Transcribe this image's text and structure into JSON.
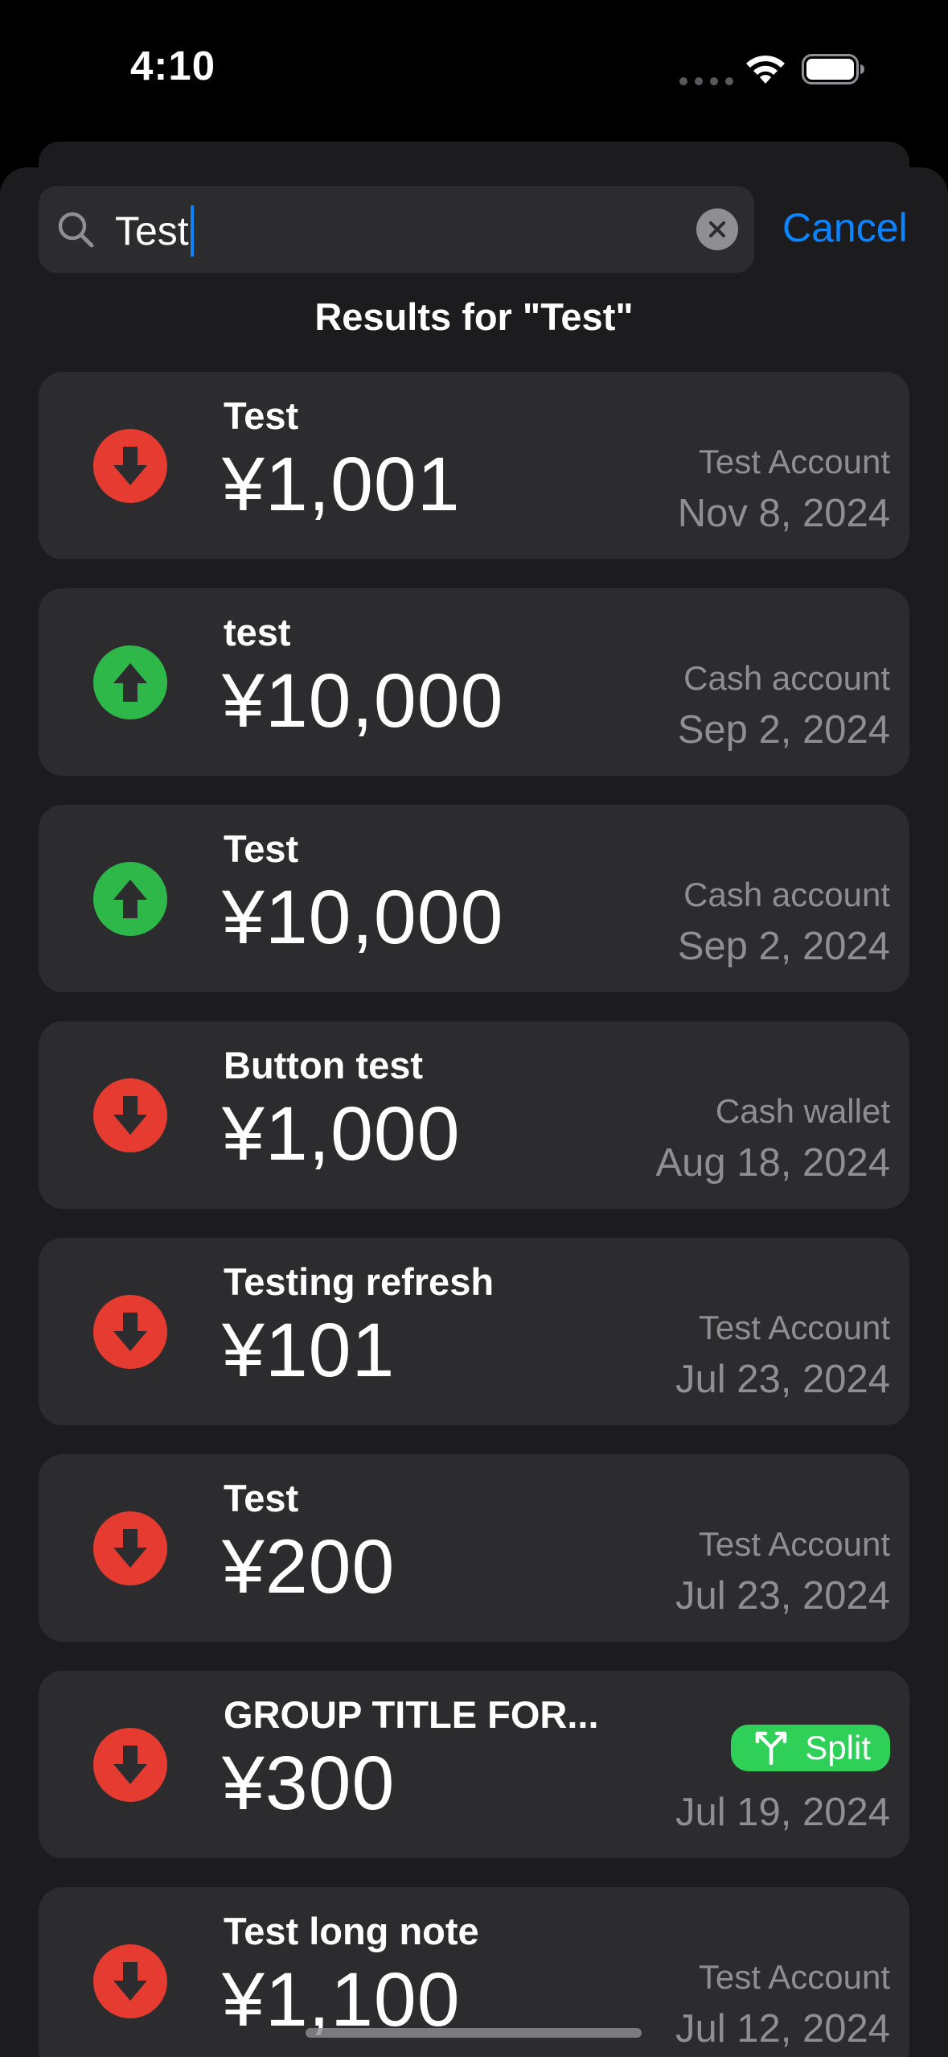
{
  "status_bar": {
    "time": "4:10"
  },
  "search": {
    "query": "Test",
    "cancel_label": "Cancel"
  },
  "results_title": "Results for \"Test\"",
  "transactions": [
    {
      "title": "Test",
      "amount": "¥1,001",
      "account": "Test Account",
      "date": "Nov 8, 2024",
      "direction": "expense",
      "icon": "arrow-down-icon"
    },
    {
      "title": "test",
      "amount": "¥10,000",
      "account": "Cash account",
      "date": "Sep 2, 2024",
      "direction": "income",
      "icon": "arrow-up-icon"
    },
    {
      "title": "Test",
      "amount": "¥10,000",
      "account": "Cash account",
      "date": "Sep 2, 2024",
      "direction": "income",
      "icon": "arrow-up-icon"
    },
    {
      "title": "Button test",
      "amount": "¥1,000",
      "account": "Cash wallet",
      "date": "Aug 18, 2024",
      "direction": "expense",
      "icon": "arrow-down-icon"
    },
    {
      "title": "Testing refresh",
      "amount": "¥101",
      "account": "Test Account",
      "date": "Jul 23, 2024",
      "direction": "expense",
      "icon": "arrow-down-icon"
    },
    {
      "title": "Test",
      "amount": "¥200",
      "account": "Test Account",
      "date": "Jul 23, 2024",
      "direction": "expense",
      "icon": "arrow-down-icon"
    },
    {
      "title": "GROUP TITLE FOR...",
      "amount": "¥300",
      "badge": "Split",
      "badge_icon": "split-icon",
      "date": "Jul 19, 2024",
      "direction": "expense",
      "icon": "arrow-down-icon"
    },
    {
      "title": "Test long note",
      "amount": "¥1,100",
      "account": "Test Account",
      "date": "Jul 12, 2024",
      "direction": "expense",
      "icon": "arrow-down-icon"
    }
  ],
  "colors": {
    "expense": "#e53b30",
    "income": "#2fb84a",
    "split_badge": "#2fd058",
    "accent": "#0a84ff"
  }
}
